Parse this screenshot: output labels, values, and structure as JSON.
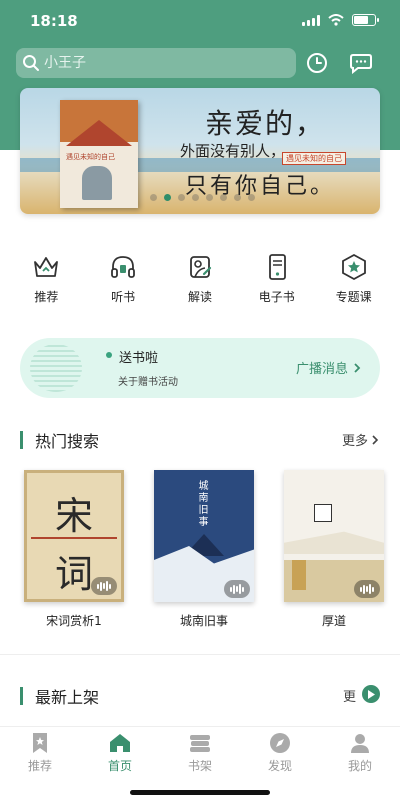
{
  "status": {
    "time": "18:18",
    "battery_level": 0.75
  },
  "search": {
    "placeholder": "小王子"
  },
  "header": {
    "history_icon": "clock-icon",
    "message_icon": "chat-bubble-icon"
  },
  "banner": {
    "line1": "亲爱的，",
    "line2": "外面没有别人，",
    "line3": "只有你自己。",
    "book_title": "遇见未知的自己",
    "tag": "遇见未知的自己",
    "dots_total": 8,
    "dots_active": 1
  },
  "quicknav": [
    {
      "label": "推荐",
      "icon": "crown-icon"
    },
    {
      "label": "听书",
      "icon": "headphones-icon"
    },
    {
      "label": "解读",
      "icon": "edit-card-icon"
    },
    {
      "label": "电子书",
      "icon": "ebook-reader-icon"
    },
    {
      "label": "专题课",
      "icon": "star-badge-icon"
    }
  ],
  "promo": {
    "title": "送书啦",
    "subtitle": "关于赠书活动",
    "link": "广播消息"
  },
  "hot_search": {
    "title": "热门搜索",
    "more": "更多",
    "books": [
      {
        "title": "宋词赏析1",
        "cover_text_top": "宋",
        "cover_text_bottom": "词"
      },
      {
        "title": "城南旧事",
        "cover_text": "城南旧事"
      },
      {
        "title": "厚道",
        "cover_text": ""
      }
    ]
  },
  "new_arrivals": {
    "title": "最新上架",
    "more": "更"
  },
  "colors": {
    "primary": "#4e9e7f",
    "accent": "#3a8f6e",
    "promo_bg": "#dff6ee"
  },
  "tabbar": [
    {
      "label": "推荐",
      "icon": "bookmark-icon",
      "active": false
    },
    {
      "label": "首页",
      "icon": "home-icon",
      "active": true
    },
    {
      "label": "书架",
      "icon": "bookshelf-icon",
      "active": false
    },
    {
      "label": "发现",
      "icon": "compass-icon",
      "active": false
    },
    {
      "label": "我的",
      "icon": "user-icon",
      "active": false
    }
  ]
}
